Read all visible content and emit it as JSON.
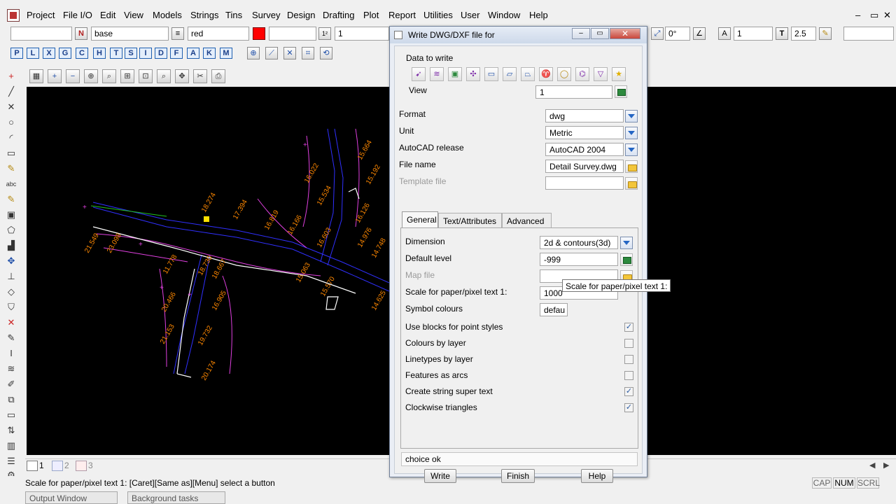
{
  "menubar": {
    "items": [
      "Project",
      "File I/O",
      "Edit",
      "View",
      "Models",
      "Strings",
      "Tins",
      "Survey",
      "Design",
      "Drafting",
      "Plot",
      "Report",
      "Utilities",
      "User",
      "Window",
      "Help"
    ],
    "window_buttons": [
      "–",
      "▭",
      "✕"
    ]
  },
  "toolbar1": {
    "name_flag": "N",
    "model_value": "base",
    "colour_value": "red",
    "colour_swatch": "#ff0000",
    "level_value": "1",
    "angle_value": "0°",
    "text_size_value": "1",
    "text_height_value": "2.5"
  },
  "toolbar2": {
    "letters": [
      "P",
      "L",
      "X",
      "G",
      "C",
      "H",
      "T",
      "S",
      "I",
      "D",
      "F",
      "A",
      "K",
      "M"
    ]
  },
  "view_tools": [
    "new-view-icon",
    "zoom-in-icon",
    "zoom-out-icon",
    "zoom-window-icon",
    "zoom-region-icon",
    "zoom-pan-icon",
    "zoom-fit-icon",
    "zoom-extent-icon",
    "pan-icon",
    "clean-icon",
    "plot-icon"
  ],
  "canvas": {
    "labels": [
      "18.274",
      "17.394",
      "16.819",
      "16.166",
      "16.603",
      "16.022",
      "15.664",
      "15.534",
      "16.126",
      "15.192",
      "14.976",
      "14.748",
      "15.063",
      "15.570",
      "16.905",
      "18.730",
      "18.667",
      "11.778",
      "20.466",
      "21.153",
      "23.098",
      "21.549",
      "19.732",
      "20.174",
      "14.625"
    ]
  },
  "dialog": {
    "title": "Write DWG/DXF file for",
    "group_label": "Data to write",
    "view_label": "View",
    "view_value": "1",
    "format_label": "Format",
    "format_value": "dwg",
    "unit_label": "Unit",
    "unit_value": "Metric",
    "autocad_label": "AutoCAD release",
    "autocad_value": "AutoCAD 2004",
    "filename_label": "File name",
    "filename_value": "Detail Survey.dwg",
    "template_label": "Template file",
    "template_value": "",
    "tabs": [
      "General",
      "Text/Attributes",
      "Advanced"
    ],
    "general": {
      "dimension_label": "Dimension",
      "dimension_value": "2d & contours(3d)",
      "default_level_label": "Default level",
      "default_level_value": "-999",
      "map_file_label": "Map file",
      "map_file_value": "",
      "scale_label": "Scale for paper/pixel text 1:",
      "scale_value": "1000",
      "symbol_colours_label": "Symbol colours",
      "symbol_colours_value": "defau",
      "checks": [
        {
          "label": "Use blocks for point styles",
          "checked": true
        },
        {
          "label": "Colours by layer",
          "checked": false
        },
        {
          "label": "Linetypes by layer",
          "checked": false
        },
        {
          "label": "Features as arcs",
          "checked": false
        },
        {
          "label": "Create string super text",
          "checked": true
        },
        {
          "label": "Clockwise triangles",
          "checked": true
        }
      ]
    },
    "tooltip": "Scale for paper/pixel text 1:",
    "message": "choice ok",
    "buttons": {
      "write": "Write",
      "finish": "Finish",
      "help": "Help"
    }
  },
  "tabbar": {
    "views": [
      "1",
      "2",
      "3"
    ]
  },
  "status": {
    "message": "Scale for paper/pixel text 1: [Caret][Same as][Menu] select a button",
    "indicators": [
      "CAP",
      "NUM",
      "SCRL"
    ]
  },
  "bottom_tabs": [
    "Output Window",
    "Background tasks"
  ]
}
